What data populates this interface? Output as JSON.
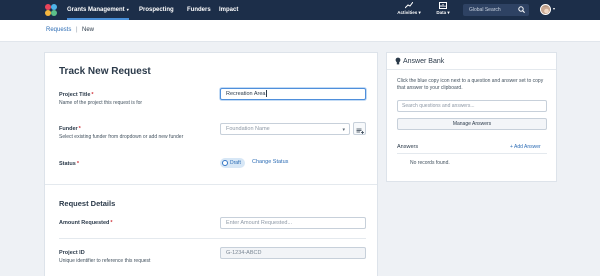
{
  "nav": {
    "items": [
      {
        "label": "Grants Management",
        "caret": "▾"
      },
      {
        "label": "Prospecting"
      },
      {
        "label": "Funders"
      },
      {
        "label": "Impact"
      }
    ],
    "activities": {
      "label": "Activities",
      "caret": "▾"
    },
    "data": {
      "label": "Data",
      "caret": "▾"
    },
    "search_placeholder": "Global Search",
    "avatar_caret": "▾"
  },
  "breadcrumb": {
    "items": [
      "Requests",
      "New"
    ],
    "separator": "|"
  },
  "form": {
    "title": "Track New Request",
    "project_title": {
      "label": "Project Title",
      "required": "*",
      "help": "Name of the project this request is for",
      "value": "Recreation Area"
    },
    "funder": {
      "label": "Funder",
      "required": "*",
      "help": "Select existing funder from dropdown or add new funder",
      "placeholder": "Foundation Name"
    },
    "status": {
      "label": "Status",
      "required": "*",
      "value": "Draft",
      "change_label": "Change Status"
    },
    "section_title": "Request Details",
    "amount_requested": {
      "label": "Amount Requested",
      "required": "*",
      "placeholder": "Enter Amount Requested..."
    },
    "project_id": {
      "label": "Project ID",
      "help": "Unique identifier to reference this request",
      "value": "G-1234-ABCD"
    }
  },
  "answer_bank": {
    "title": "Answer Bank",
    "description": "Click the blue copy icon next to a question and answer set to copy that answer to your clipboard.",
    "search_placeholder": "Search questions and answers...",
    "manage_label": "Manage Answers",
    "answers_label": "Answers",
    "add_label": "+ Add Answer",
    "empty_text": "No records found."
  },
  "colors": {
    "nav_bg": "#1c2e49",
    "accent": "#2d6db5",
    "required": "#d0343b",
    "page_bg": "#eef1f5"
  },
  "icons": [
    "logo-icon",
    "chart-icon",
    "report-icon",
    "search-icon",
    "dropdown-icon",
    "add-funder-icon",
    "bulb-icon"
  ]
}
